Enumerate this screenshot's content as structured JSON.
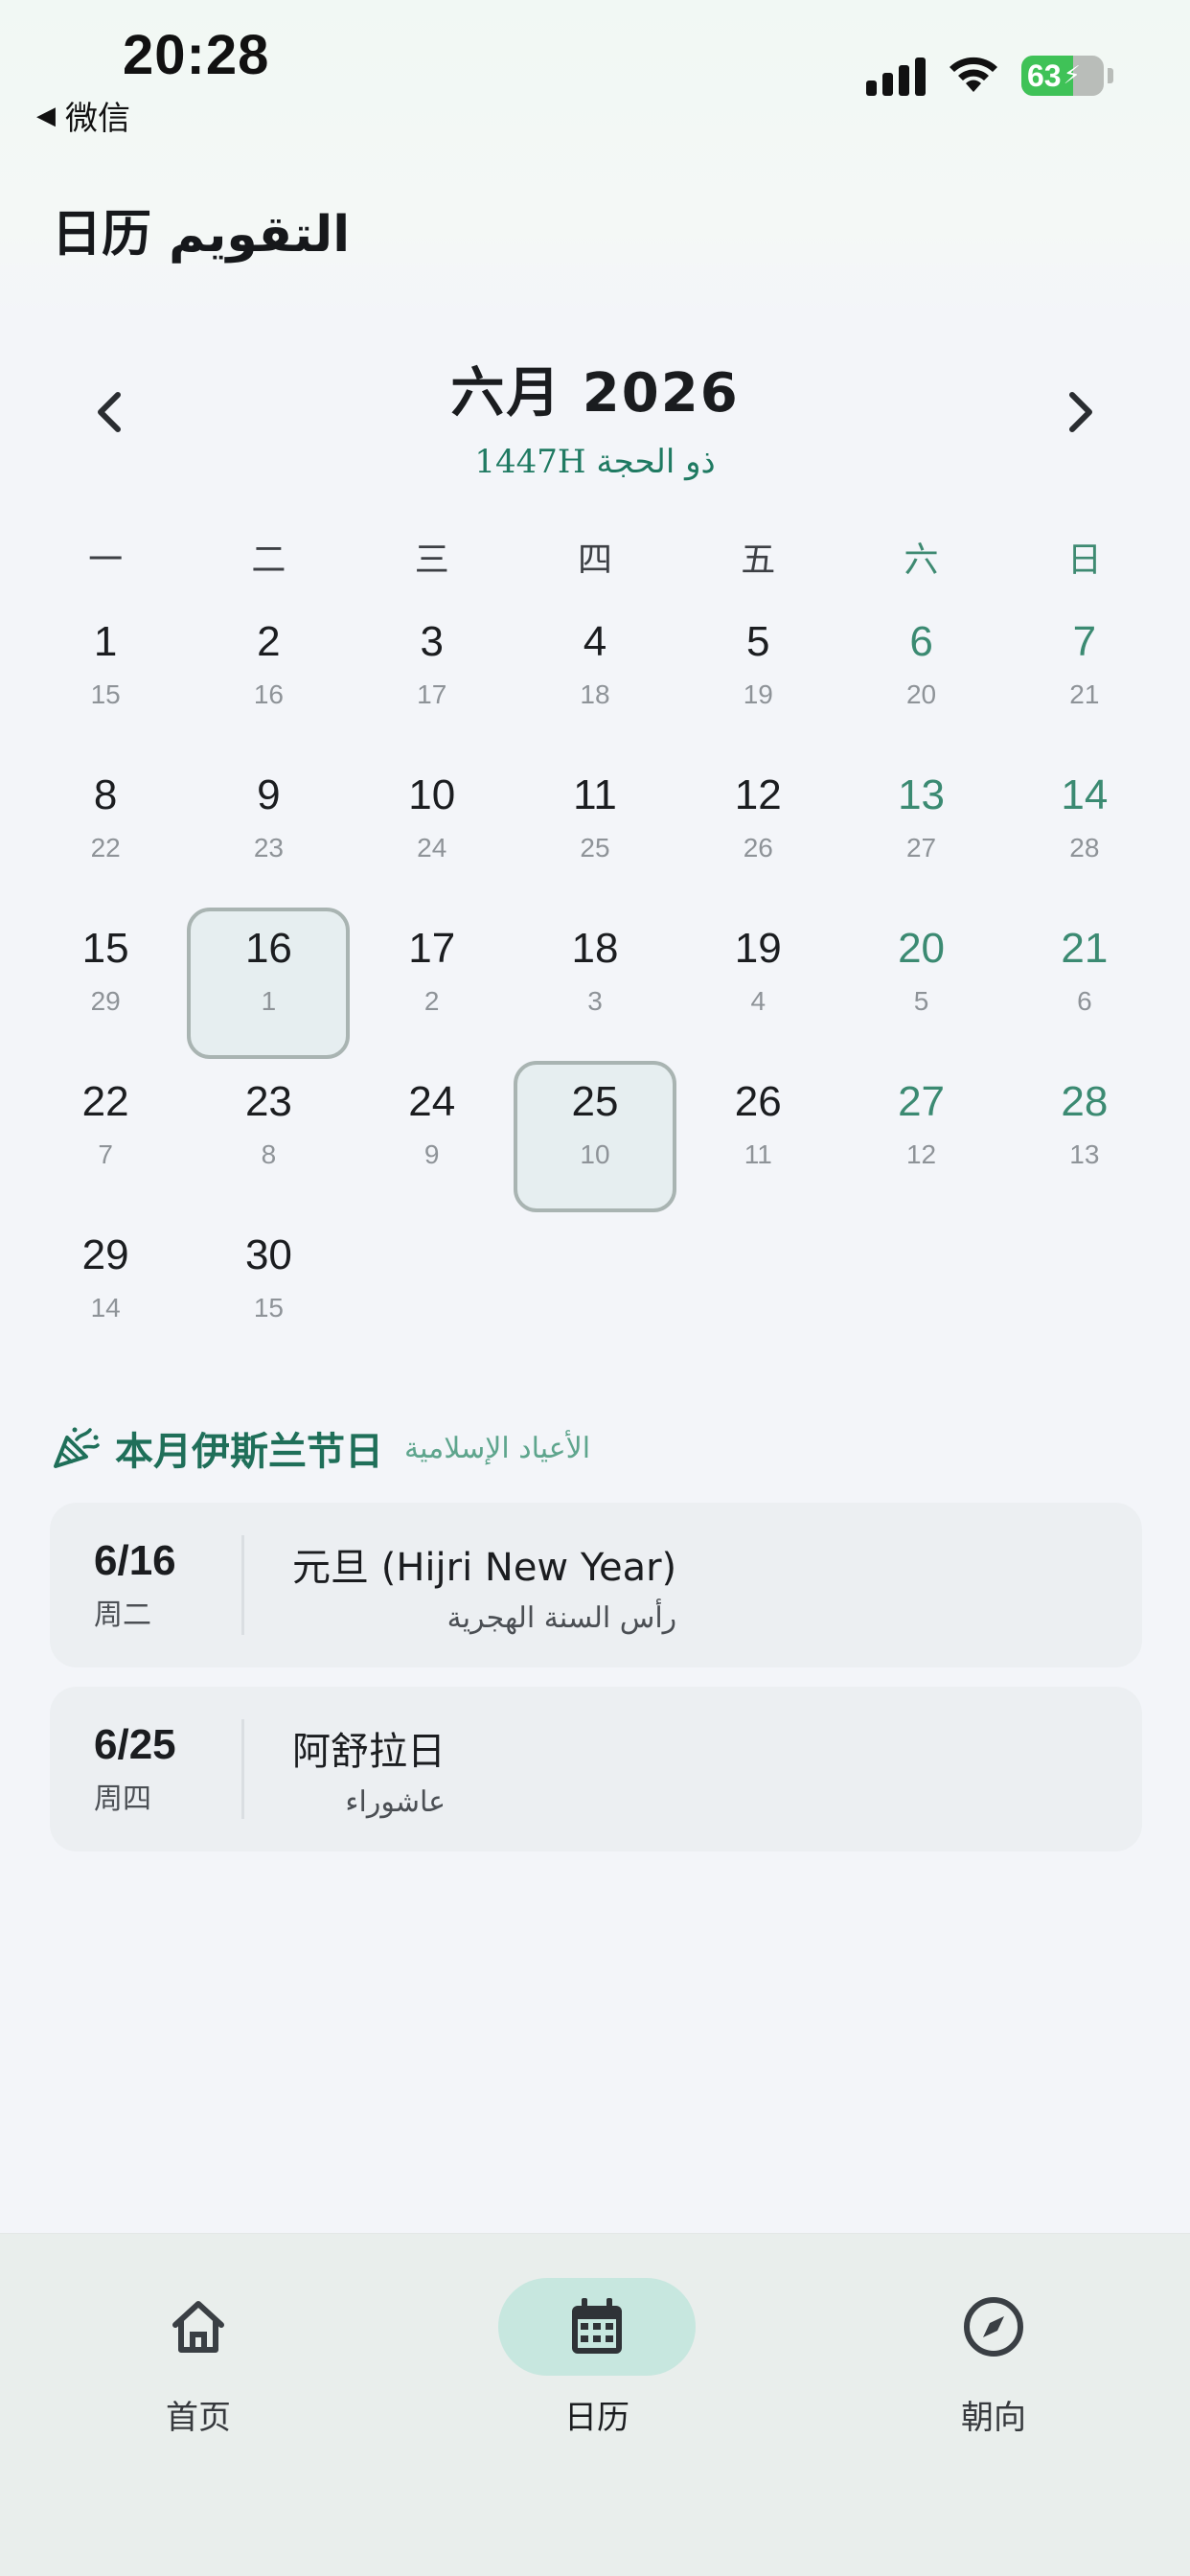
{
  "status_bar": {
    "time": "20:28",
    "back_label": "微信",
    "battery_level": 63,
    "battery_label": "63"
  },
  "header": {
    "title": "日历  التقويم"
  },
  "calendar": {
    "month_title": "六月 2026",
    "hijri_month": "ذو الحجة 1447H",
    "prev_icon": "chevron-left-icon",
    "next_icon": "chevron-right-icon",
    "weekdays": [
      "一",
      "二",
      "三",
      "四",
      "五",
      "六",
      "日"
    ],
    "days": [
      {
        "g": "1",
        "h": "15"
      },
      {
        "g": "2",
        "h": "16"
      },
      {
        "g": "3",
        "h": "17"
      },
      {
        "g": "4",
        "h": "18"
      },
      {
        "g": "5",
        "h": "19"
      },
      {
        "g": "6",
        "h": "20"
      },
      {
        "g": "7",
        "h": "21"
      },
      {
        "g": "8",
        "h": "22"
      },
      {
        "g": "9",
        "h": "23"
      },
      {
        "g": "10",
        "h": "24"
      },
      {
        "g": "11",
        "h": "25"
      },
      {
        "g": "12",
        "h": "26"
      },
      {
        "g": "13",
        "h": "27"
      },
      {
        "g": "14",
        "h": "28"
      },
      {
        "g": "15",
        "h": "29"
      },
      {
        "g": "16",
        "h": "1"
      },
      {
        "g": "17",
        "h": "2"
      },
      {
        "g": "18",
        "h": "3"
      },
      {
        "g": "19",
        "h": "4"
      },
      {
        "g": "20",
        "h": "5"
      },
      {
        "g": "21",
        "h": "6"
      },
      {
        "g": "22",
        "h": "7"
      },
      {
        "g": "23",
        "h": "8"
      },
      {
        "g": "24",
        "h": "9"
      },
      {
        "g": "25",
        "h": "10"
      },
      {
        "g": "26",
        "h": "11"
      },
      {
        "g": "27",
        "h": "12"
      },
      {
        "g": "28",
        "h": "13"
      },
      {
        "g": "29",
        "h": "14"
      },
      {
        "g": "30",
        "h": "15"
      }
    ],
    "holiday_days": [
      "16",
      "25"
    ]
  },
  "holidays": {
    "title": "本月伊斯兰节日",
    "title_ar": "الأعياد الإسلامية",
    "icon": "party-popper-icon",
    "items": [
      {
        "date": "6/16",
        "weekday": "周二",
        "name": "元旦 (Hijri New Year)",
        "name_ar": "رأس السنة الهجرية"
      },
      {
        "date": "6/25",
        "weekday": "周四",
        "name": "阿舒拉日",
        "name_ar": "عاشوراء"
      }
    ]
  },
  "tabbar": {
    "tabs": [
      {
        "label": "首页",
        "icon": "home-icon"
      },
      {
        "label": "日历",
        "icon": "calendar-icon"
      },
      {
        "label": "朝向",
        "icon": "compass-icon"
      }
    ],
    "active_index": 1
  },
  "colors": {
    "accent": "#1f7a62",
    "weekend": "#3b8a72",
    "holiday_outline": "#a9b4b2",
    "tab_active_bg": "#c7e7df"
  }
}
